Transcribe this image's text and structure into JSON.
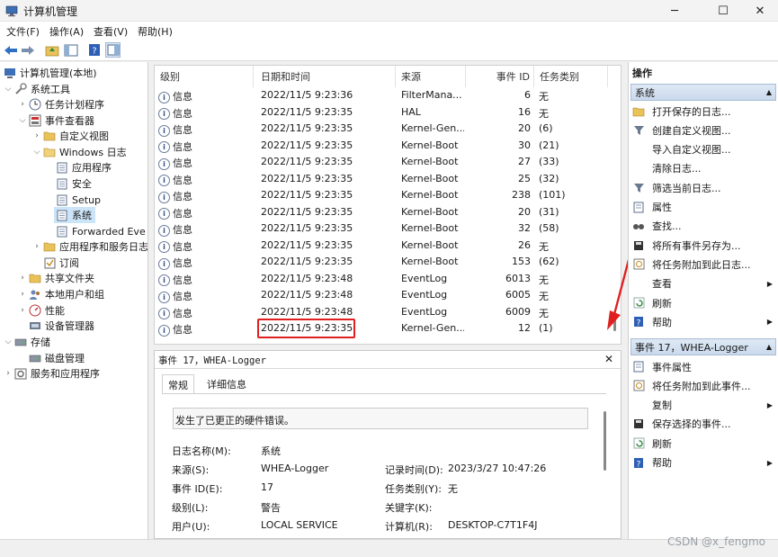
{
  "window": {
    "title": "计算机管理",
    "minimize": "─",
    "maximize": "☐",
    "close": "✕"
  },
  "menu": [
    "文件(F)",
    "操作(A)",
    "查看(V)",
    "帮助(H)"
  ],
  "tree": [
    {
      "label": "计算机管理(本地)",
      "level": 0,
      "exp": ""
    },
    {
      "label": "系统工具",
      "level": 1,
      "exp": "⌵"
    },
    {
      "label": "任务计划程序",
      "level": 2,
      "exp": "›"
    },
    {
      "label": "事件查看器",
      "level": 2,
      "exp": "⌵"
    },
    {
      "label": "自定义视图",
      "level": 3,
      "exp": "›"
    },
    {
      "label": "Windows 日志",
      "level": 3,
      "exp": "⌵"
    },
    {
      "label": "应用程序",
      "level": 4,
      "exp": ""
    },
    {
      "label": "安全",
      "level": 4,
      "exp": ""
    },
    {
      "label": "Setup",
      "level": 4,
      "exp": ""
    },
    {
      "label": "系统",
      "level": 4,
      "exp": "",
      "selected": true
    },
    {
      "label": "Forwarded Eve",
      "level": 4,
      "exp": ""
    },
    {
      "label": "应用程序和服务日志",
      "level": 3,
      "exp": "›"
    },
    {
      "label": "订阅",
      "level": 3,
      "exp": ""
    },
    {
      "label": "共享文件夹",
      "level": 2,
      "exp": "›"
    },
    {
      "label": "本地用户和组",
      "level": 2,
      "exp": "›"
    },
    {
      "label": "性能",
      "level": 2,
      "exp": "›"
    },
    {
      "label": "设备管理器",
      "level": 2,
      "exp": ""
    },
    {
      "label": "存储",
      "level": 1,
      "exp": "⌵"
    },
    {
      "label": "磁盘管理",
      "level": 2,
      "exp": ""
    },
    {
      "label": "服务和应用程序",
      "level": 1,
      "exp": "›"
    }
  ],
  "grid": {
    "columns": [
      "级别",
      "日期和时间",
      "来源",
      "事件 ID",
      "任务类别"
    ],
    "rows": [
      [
        "信息",
        "2022/11/5 9:23:36",
        "FilterMana...",
        "6",
        "无"
      ],
      [
        "信息",
        "2022/11/5 9:23:35",
        "HAL",
        "16",
        "无"
      ],
      [
        "信息",
        "2022/11/5 9:23:35",
        "Kernel-Gen...",
        "20",
        "(6)"
      ],
      [
        "信息",
        "2022/11/5 9:23:35",
        "Kernel-Boot",
        "30",
        "(21)"
      ],
      [
        "信息",
        "2022/11/5 9:23:35",
        "Kernel-Boot",
        "27",
        "(33)"
      ],
      [
        "信息",
        "2022/11/5 9:23:35",
        "Kernel-Boot",
        "25",
        "(32)"
      ],
      [
        "信息",
        "2022/11/5 9:23:35",
        "Kernel-Boot",
        "238",
        "(101)"
      ],
      [
        "信息",
        "2022/11/5 9:23:35",
        "Kernel-Boot",
        "20",
        "(31)"
      ],
      [
        "信息",
        "2022/11/5 9:23:35",
        "Kernel-Boot",
        "32",
        "(58)"
      ],
      [
        "信息",
        "2022/11/5 9:23:35",
        "Kernel-Boot",
        "26",
        "无"
      ],
      [
        "信息",
        "2022/11/5 9:23:35",
        "Kernel-Boot",
        "153",
        "(62)"
      ],
      [
        "信息",
        "2022/11/5 9:23:48",
        "EventLog",
        "6013",
        "无"
      ],
      [
        "信息",
        "2022/11/5 9:23:48",
        "EventLog",
        "6005",
        "无"
      ],
      [
        "信息",
        "2022/11/5 9:23:48",
        "EventLog",
        "6009",
        "无"
      ],
      [
        "信息",
        "2022/11/5 9:23:35",
        "Kernel-Gen...",
        "12",
        "(1)"
      ]
    ],
    "info_icon": "i"
  },
  "detail": {
    "title": "事件 17，WHEA-Logger",
    "close": "✕",
    "tabs": [
      "常规",
      "详细信息"
    ],
    "message": "发生了已更正的硬件错误。",
    "fields": {
      "log_name_label": "日志名称(M):",
      "log_name": "系统",
      "source_label": "来源(S):",
      "source": "WHEA-Logger",
      "logged_label": "记录时间(D):",
      "logged": "2023/3/27 10:47:26",
      "event_id_label": "事件 ID(E):",
      "event_id": "17",
      "task_label": "任务类别(Y):",
      "task": "无",
      "level_label": "级别(L):",
      "level": "警告",
      "keywords_label": "关键字(K):",
      "keywords": "",
      "user_label": "用户(U):",
      "user": "LOCAL SERVICE",
      "computer_label": "计算机(R):",
      "computer": "DESKTOP-C7T1F4J"
    }
  },
  "actions": {
    "header": "操作",
    "section1": "系统",
    "items1": [
      "打开保存的日志...",
      "创建自定义视图...",
      "导入自定义视图...",
      "清除日志...",
      "筛选当前日志...",
      "属性",
      "查找...",
      "将所有事件另存为...",
      "将任务附加到此日志...",
      "查看",
      "刷新",
      "帮助"
    ],
    "section2": "事件 17，WHEA-Logger",
    "items2": [
      "事件属性",
      "将任务附加到此事件...",
      "复制",
      "保存选择的事件...",
      "刷新",
      "帮助"
    ]
  },
  "watermark": "CSDN @x_fengmo",
  "colors": {
    "highlight_box": "#e02020",
    "arrow": "#e02020",
    "selection": "#cce4f7",
    "section_header": "#d4e1f1"
  }
}
